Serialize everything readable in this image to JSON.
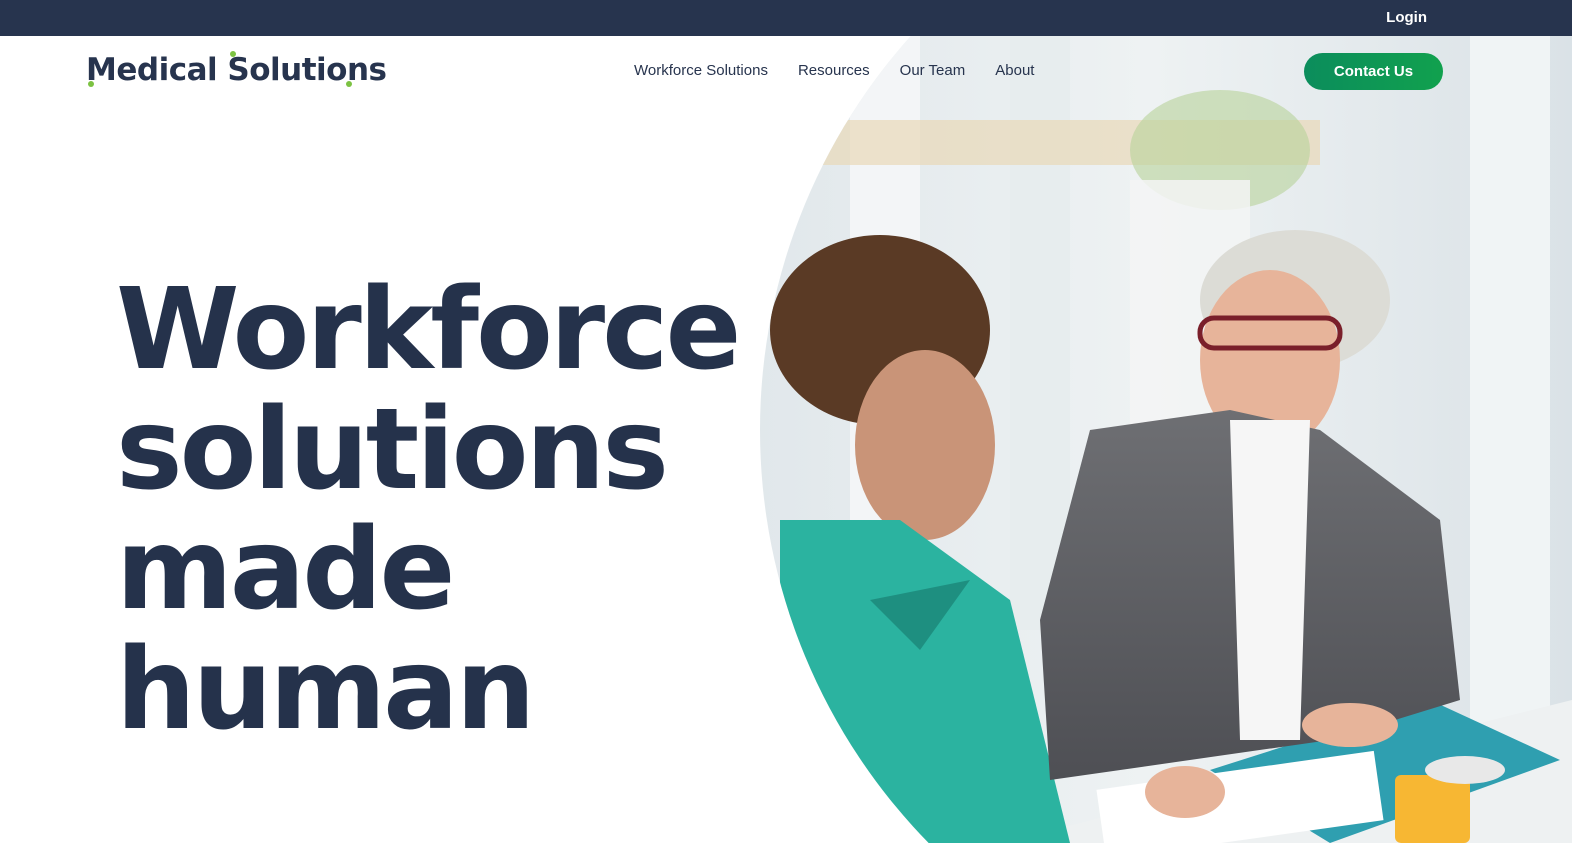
{
  "topbar": {
    "login_label": "Login"
  },
  "header": {
    "logo_text": "Medical Solutions",
    "nav": [
      {
        "label": "Workforce Solutions"
      },
      {
        "label": "Resources"
      },
      {
        "label": "Our Team"
      },
      {
        "label": "About"
      }
    ],
    "contact_label": "Contact Us"
  },
  "hero": {
    "headline_lines": [
      "Workforce",
      "solutions",
      "made",
      "human"
    ],
    "image_description_icon": "photo-nurse-and-executive-meeting"
  },
  "colors": {
    "navy": "#27344e",
    "green_accent": "#7cc242",
    "button_green": "#0b8d5c",
    "scrubs_teal": "#2bb3a0"
  }
}
